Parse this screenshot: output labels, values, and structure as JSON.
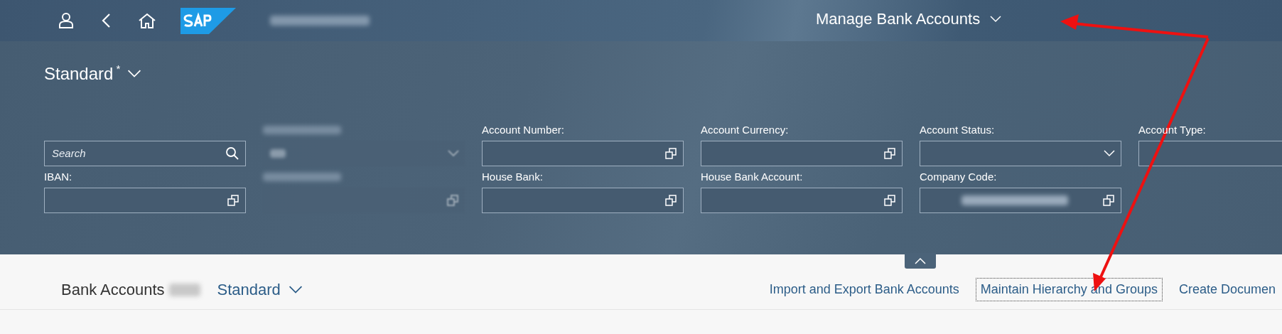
{
  "shell": {
    "title": "Manage Bank Accounts"
  },
  "variant": {
    "label": "Standard",
    "modified_mark": "*"
  },
  "filter_rows": [
    [
      {
        "kind": "search",
        "placeholder": "Search"
      },
      {
        "kind": "select",
        "redacted": true
      },
      {
        "kind": "value_help",
        "label": "Account Number:"
      },
      {
        "kind": "value_help",
        "label": "Account Currency:"
      },
      {
        "kind": "select",
        "label": "Account Status:"
      },
      {
        "kind": "plain",
        "label": "Account Type:"
      }
    ],
    [
      {
        "kind": "value_help",
        "label": "IBAN:"
      },
      {
        "kind": "value_help",
        "redacted": true
      },
      {
        "kind": "value_help",
        "label": "House Bank:"
      },
      {
        "kind": "value_help",
        "label": "House Bank Account:"
      },
      {
        "kind": "value_help",
        "label": "Company Code:",
        "redacted_value": true
      }
    ]
  ],
  "table_toolbar": {
    "title": "Bank Accounts",
    "variant": "Standard",
    "actions": [
      {
        "label": "Import and Export Bank Accounts",
        "focused": false
      },
      {
        "label": "Maintain Hierarchy and Groups",
        "focused": true
      },
      {
        "label": "Create Documen",
        "focused": false
      }
    ]
  }
}
